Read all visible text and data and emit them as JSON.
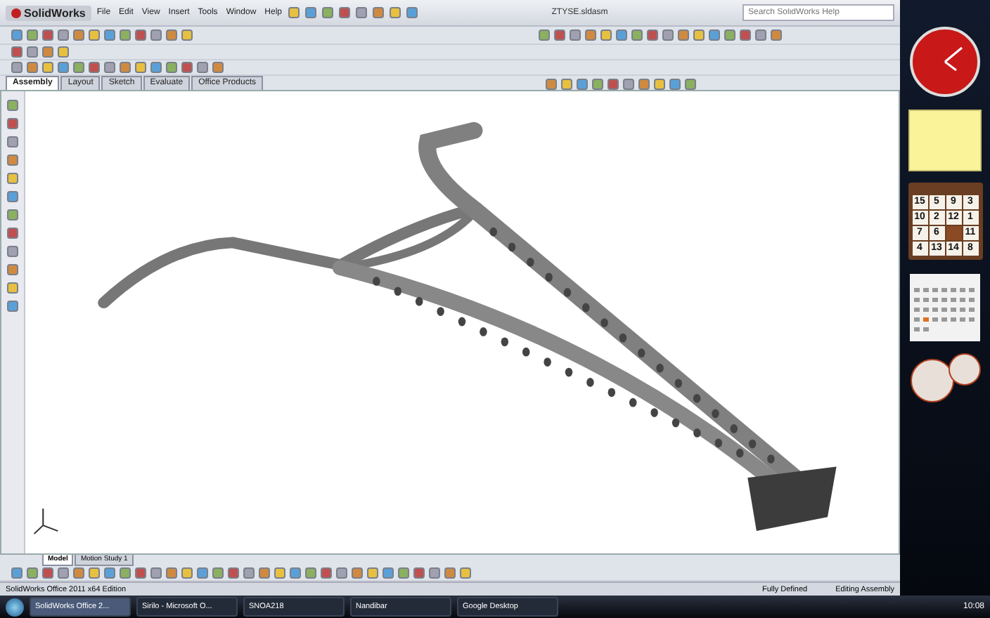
{
  "app": {
    "logo": "SolidWorks",
    "menu": [
      "File",
      "Edit",
      "View",
      "Insert",
      "Tools",
      "Window",
      "Help"
    ],
    "title": "ZTYSE.sldasm",
    "search": {
      "placeholder": "Search SolidWorks Help"
    }
  },
  "tabs": [
    {
      "label": "Assembly",
      "selected": true
    },
    {
      "label": "Layout",
      "selected": false
    },
    {
      "label": "Sketch",
      "selected": false
    },
    {
      "label": "Evaluate",
      "selected": false
    },
    {
      "label": "Office Products",
      "selected": false
    }
  ],
  "bottom_tabs": [
    {
      "label": "Model",
      "selected": true
    },
    {
      "label": "Motion Study 1",
      "selected": false
    }
  ],
  "status_bar": {
    "product": "SolidWorks Office 2011 x64 Edition",
    "state": "Fully Defined",
    "mode": "Editing Assembly"
  },
  "puzzle": [
    {
      "kind": "number",
      "label": "15"
    },
    {
      "kind": "number",
      "label": "5"
    },
    {
      "kind": "number",
      "label": "9"
    },
    {
      "kind": "number",
      "label": "3"
    },
    {
      "kind": "number",
      "label": "10"
    },
    {
      "kind": "number",
      "label": "2"
    },
    {
      "kind": "number",
      "label": "12"
    },
    {
      "kind": "number",
      "label": "1"
    },
    {
      "kind": "number",
      "label": "7"
    },
    {
      "kind": "number",
      "label": "6"
    },
    {
      "kind": "blank"
    },
    {
      "kind": "number",
      "label": "11"
    },
    {
      "kind": "number",
      "label": "4"
    },
    {
      "kind": "number",
      "label": "13"
    },
    {
      "kind": "number",
      "label": "14"
    },
    {
      "kind": "number",
      "label": "8"
    }
  ],
  "taskbar": {
    "items": [
      {
        "label": "SolidWorks Office 2...",
        "selected": true
      },
      {
        "label": "Sirilo - Microsoft O...",
        "selected": false
      },
      {
        "label": "SNOA218",
        "selected": false
      },
      {
        "label": "Nandibar",
        "selected": false
      },
      {
        "label": "Google Desktop",
        "selected": false
      }
    ],
    "clock": "10:08"
  }
}
